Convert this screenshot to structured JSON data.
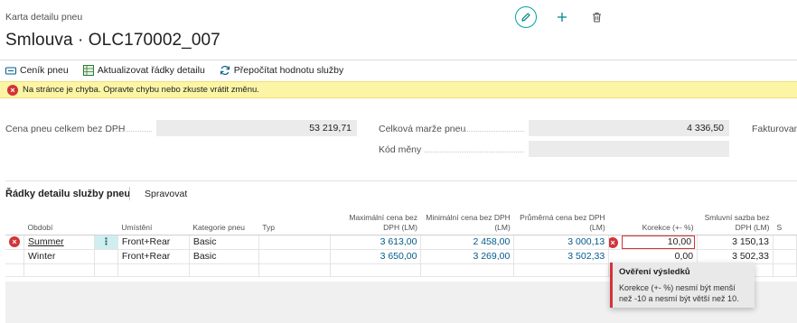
{
  "header": {
    "caption": "Karta detailu pneu",
    "title": "Smlouva · OLC170002_007"
  },
  "actions": [
    {
      "label": "Ceník pneu",
      "icon": "price-list-icon"
    },
    {
      "label": "Aktualizovat řádky detailu",
      "icon": "sheet-refresh-icon"
    },
    {
      "label": "Přepočítat hodnotu služby",
      "icon": "recalculate-icon"
    }
  ],
  "error_banner": {
    "text": "Na stránce je chyba. Opravte chybu nebo zkuste vrátit změnu."
  },
  "fields": {
    "price_total_label": "Cena pneu celkem bez DPH",
    "price_total_value": "53 219,71",
    "margin_label": "Celková marže pneu",
    "margin_value": "4 336,50",
    "currency_label": "Kód měny",
    "currency_value": "",
    "invoiced_label": "Fakturované"
  },
  "lines": {
    "title": "Řádky detailu služby pneu",
    "manage_label": "Spravovat",
    "columns": {
      "period": "Období",
      "location": "Umístění",
      "category": "Kategorie pneu",
      "type": "Typ",
      "max_price": "Maximální cena bez DPH (LM)",
      "min_price": "Minimální cena bez DPH (LM)",
      "avg_price": "Průměrná cena bez DPH (LM)",
      "correction": "Korekce (+- %)",
      "contract_rate": "Smluvní sazba bez DPH (LM)",
      "next": "S"
    },
    "rows": [
      {
        "period": "Summer",
        "location": "Front+Rear",
        "category": "Basic",
        "type": "",
        "max_price": "3 613,00",
        "min_price": "2 458,00",
        "avg_price": "3 000,13",
        "correction": "10,00",
        "contract_rate": "3 150,13"
      },
      {
        "period": "Winter",
        "location": "Front+Rear",
        "category": "Basic",
        "type": "",
        "max_price": "3 650,00",
        "min_price": "3 269,00",
        "avg_price": "3 502,33",
        "correction": "0,00",
        "contract_rate": "3 502,33"
      }
    ]
  },
  "tooltip": {
    "title": "Ověření výsledků",
    "text": "Korekce (+- %) nesmí být menší než -10 a nesmí být větší než 10."
  },
  "colors": {
    "accent": "#008489",
    "error": "#d13438",
    "banner": "#fcf5a5"
  }
}
